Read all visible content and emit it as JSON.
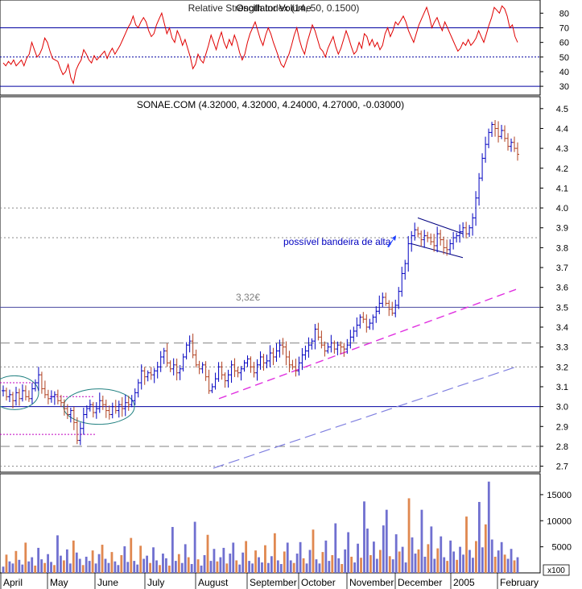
{
  "chart_data": [
    {
      "type": "line",
      "title": "Relative Strength Index (14, 50, 0.1500)",
      "title_overlap": "Oscillator Volume",
      "ylim": [
        24,
        89
      ],
      "yticks": [
        30,
        40,
        50,
        60,
        70,
        80
      ],
      "reference_lines": [
        {
          "y": 70,
          "style": "solid"
        },
        {
          "y": 50,
          "style": "dotted"
        },
        {
          "y": 30,
          "style": "solid"
        }
      ],
      "series": [
        {
          "values": [
            46,
            44,
            47,
            45,
            48,
            44,
            46,
            48,
            44,
            49,
            52,
            60,
            55,
            50,
            52,
            56,
            63,
            60,
            54,
            49,
            48,
            47,
            42,
            38,
            40,
            45,
            36,
            32,
            41,
            45,
            48,
            55,
            52,
            48,
            46,
            51,
            48,
            50,
            52,
            54,
            49,
            53,
            56,
            52,
            55,
            58,
            62,
            66,
            70,
            73,
            78,
            72,
            70,
            74,
            77,
            74,
            68,
            64,
            66,
            72,
            76,
            80,
            73,
            66,
            70,
            63,
            60,
            68,
            64,
            58,
            62,
            56,
            50,
            42,
            45,
            52,
            48,
            46,
            52,
            58,
            65,
            60,
            55,
            62,
            67,
            60,
            56,
            62,
            58,
            65,
            60,
            53,
            48,
            52,
            60,
            66,
            70,
            74,
            68,
            62,
            58,
            65,
            70,
            66,
            60,
            55,
            50,
            45,
            43,
            48,
            52,
            58,
            65,
            70,
            62,
            56,
            52,
            60,
            66,
            72,
            68,
            62,
            56,
            54,
            50,
            56,
            60,
            64,
            57,
            52,
            56,
            62,
            68,
            63,
            57,
            52,
            54,
            60,
            56,
            66,
            64,
            58,
            62,
            57,
            60,
            55,
            58,
            66,
            70,
            64,
            68,
            74,
            72,
            75,
            78,
            74,
            68,
            64,
            60,
            66,
            72,
            76,
            80,
            84,
            78,
            70,
            74,
            77,
            72,
            68,
            74,
            70,
            66,
            62,
            58,
            54,
            56,
            60,
            58,
            62,
            58,
            60,
            63,
            68,
            64,
            60,
            66,
            72,
            77,
            84,
            82,
            80,
            85,
            83,
            78,
            70,
            72,
            64,
            60
          ]
        }
      ]
    },
    {
      "type": "line",
      "title": "SONAE.COM (4.32000, 4.32000, 4.24000, 4.27000, -0.03000)",
      "ylim": [
        2.67,
        4.56
      ],
      "yticks": [
        2.7,
        2.8,
        2.9,
        3.0,
        3.1,
        3.2,
        3.3,
        3.4,
        3.5,
        3.6,
        3.7,
        3.8,
        3.9,
        4.0,
        4.1,
        4.2,
        4.3,
        4.4,
        4.5
      ],
      "series": [
        {
          "values": [
            3.08,
            3.05,
            3.06,
            3.03,
            3.07,
            3.04,
            3.08,
            3.05,
            3.04,
            3.09,
            3.12,
            3.16,
            3.09,
            3.06,
            3.04,
            3.05,
            3.06,
            3.03,
            3.02,
            2.99,
            2.96,
            2.98,
            2.92,
            2.83,
            2.89,
            2.96,
            2.99,
            3.01,
            2.97,
            2.99,
            3.03,
            3.01,
            2.98,
            2.96,
            3.0,
            2.98,
            3.01,
            2.99,
            3.02,
            3.01,
            3.03,
            3.07,
            3.12,
            3.18,
            3.15,
            3.17,
            3.16,
            3.18,
            3.2,
            3.25,
            3.28,
            3.22,
            3.19,
            3.21,
            3.17,
            3.19,
            3.25,
            3.31,
            3.33,
            3.26,
            3.21,
            3.19,
            3.21,
            3.15,
            3.08,
            3.1,
            3.14,
            3.2,
            3.16,
            3.13,
            3.16,
            3.21,
            3.18,
            3.17,
            3.19,
            3.22,
            3.24,
            3.2,
            3.17,
            3.21,
            3.25,
            3.22,
            3.23,
            3.27,
            3.25,
            3.28,
            3.31,
            3.3,
            3.25,
            3.21,
            3.2,
            3.18,
            3.22,
            3.26,
            3.28,
            3.31,
            3.33,
            3.39,
            3.35,
            3.31,
            3.28,
            3.3,
            3.32,
            3.29,
            3.31,
            3.3,
            3.29,
            3.31,
            3.35,
            3.38,
            3.41,
            3.45,
            3.44,
            3.4,
            3.42,
            3.45,
            3.48,
            3.52,
            3.55,
            3.52,
            3.49,
            3.47,
            3.51,
            3.58,
            3.67,
            3.72,
            3.82,
            3.86,
            3.89,
            3.87,
            3.84,
            3.86,
            3.85,
            3.83,
            3.81,
            3.87,
            3.84,
            3.8,
            3.79,
            3.82,
            3.85,
            3.86,
            3.88,
            3.9,
            3.87,
            3.9,
            3.95,
            4.05,
            4.15,
            4.25,
            4.32,
            4.38,
            4.42,
            4.4,
            4.36,
            4.39,
            4.35,
            4.31,
            4.33,
            4.3,
            4.27
          ]
        }
      ],
      "annotations": [
        {
          "text": "3,32€",
          "x_index": 74,
          "y": 3.32
        },
        {
          "text": "possível bandeira de alta",
          "x_index": 131,
          "y": 3.8
        }
      ]
    },
    {
      "type": "bar",
      "title": "Volume",
      "ylim": [
        0,
        19000
      ],
      "yticks": [
        5000,
        10000,
        15000
      ],
      "unit_label": "x100",
      "values": [
        1200,
        3500,
        2200,
        1800,
        4200,
        2500,
        1600,
        5800,
        2200,
        3000,
        1400,
        4800,
        2600,
        1900,
        3600,
        2100,
        1500,
        7200,
        3300,
        2400,
        4500,
        1800,
        6200,
        3900,
        2700,
        1500,
        3100,
        2300,
        4300,
        1800,
        3600,
        5400,
        2700,
        1900,
        4000,
        2200,
        1500,
        3400,
        5100,
        2100,
        6700,
        2300,
        1600,
        5200,
        2700,
        3300,
        1900,
        4900,
        2400,
        1500,
        3700,
        2800,
        1400,
        8800,
        2300,
        3600,
        1900,
        5500,
        3000,
        1700,
        9800,
        2600,
        1400,
        3400,
        7300,
        2300,
        4600,
        2200,
        3000,
        4800,
        1800,
        3700,
        5800,
        2400,
        1600,
        3900,
        6100,
        2300,
        1800,
        4300,
        3000,
        2000,
        5300,
        1900,
        3200,
        7600,
        2400,
        1700,
        4100,
        5800,
        2400,
        1900,
        3700,
        5900,
        2800,
        1800,
        4400,
        8300,
        2600,
        1800,
        4000,
        6200,
        2300,
        3400,
        9500,
        2800,
        1700,
        4500,
        7800,
        3100,
        2000,
        5600,
        2900,
        13700,
        8500,
        3400,
        6000,
        2700,
        4400,
        9100,
        12100,
        3200,
        2600,
        7400,
        4100,
        5000,
        2000,
        14300,
        6800,
        3700,
        4500,
        12100,
        3100,
        5500,
        8900,
        2700,
        4700,
        7000,
        3000,
        2300,
        6200,
        4100,
        2500,
        5000,
        3500,
        10800,
        4400,
        2900,
        6100,
        13600,
        4900,
        9300,
        17500,
        6400,
        3100,
        4300,
        5900,
        3500,
        2700,
        4600,
        2400,
        3000
      ]
    }
  ],
  "x_axis_labels": [
    "April",
    "May",
    "June",
    "July",
    "August",
    "September",
    "October",
    "November",
    "December",
    "2005",
    "February"
  ]
}
